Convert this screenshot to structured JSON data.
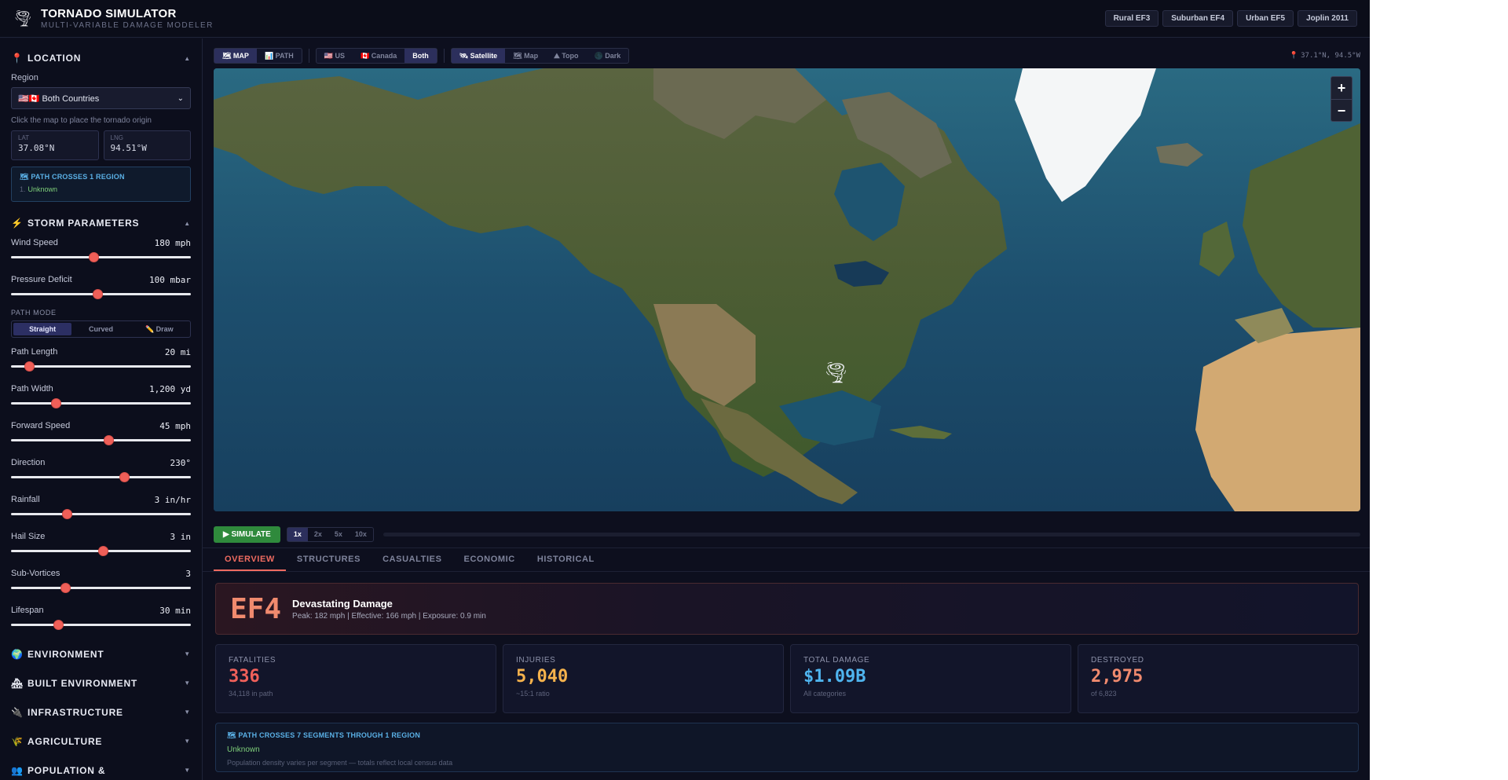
{
  "header": {
    "title": "TORNADO SIMULATOR",
    "subtitle": "MULTI-VARIABLE DAMAGE MODELER",
    "presets": [
      "Rural EF3",
      "Suburban EF4",
      "Urban EF5",
      "Joplin 2011"
    ]
  },
  "location": {
    "title": "LOCATION",
    "region_label": "Region",
    "region_value": "🇺🇸🇨🇦 Both Countries",
    "hint": "Click the map to place the tornado origin",
    "lat_label": "LAT",
    "lat_value": "37.08°N",
    "lng_label": "LNG",
    "lng_value": "94.51°W",
    "cross_title": "🗺 PATH CROSSES 1 REGION",
    "cross_index": "1.",
    "cross_item": "Unknown"
  },
  "storm": {
    "title": "STORM PARAMETERS",
    "path_mode_label": "PATH MODE",
    "path_modes": [
      "Straight",
      "Curved",
      "✏️ Draw"
    ],
    "params": [
      {
        "name": "Wind Speed",
        "value": "180 mph",
        "level": 0.46
      },
      {
        "name": "Pressure Deficit",
        "value": "100 mbar",
        "level": 0.48
      }
    ],
    "params2": [
      {
        "name": "Path Length",
        "value": "20 mi",
        "level": 0.1
      },
      {
        "name": "Path Width",
        "value": "1,200 yd",
        "level": 0.25
      },
      {
        "name": "Forward Speed",
        "value": "45 mph",
        "level": 0.54
      },
      {
        "name": "Direction",
        "value": "230°",
        "level": 0.63
      },
      {
        "name": "Rainfall",
        "value": "3 in/hr",
        "level": 0.31
      },
      {
        "name": "Hail Size",
        "value": "3 in",
        "level": 0.51
      },
      {
        "name": "Sub-Vortices",
        "value": "3",
        "level": 0.3
      },
      {
        "name": "Lifespan",
        "value": "30 min",
        "level": 0.26
      }
    ]
  },
  "collapsed_sections": [
    "ENVIRONMENT",
    "BUILT ENVIRONMENT",
    "INFRASTRUCTURE",
    "AGRICULTURE",
    "POPULATION &"
  ],
  "toolbar": {
    "view_modes": [
      "🗺 MAP",
      "📊 PATH"
    ],
    "countries": [
      "🇺🇸 US",
      "🇨🇦 Canada",
      "Both"
    ],
    "layers": [
      "🛰 Satellite",
      "🗺 Map",
      "⛰ Topo",
      "🌑 Dark"
    ],
    "coords": "37.1°N, 94.5°W"
  },
  "map": {
    "zoom_in": "+",
    "zoom_out": "−"
  },
  "sim": {
    "simulate": "▶ SIMULATE",
    "speeds": [
      "1x",
      "2x",
      "5x",
      "10x"
    ]
  },
  "tabs": [
    "OVERVIEW",
    "STRUCTURES",
    "CASUALTIES",
    "ECONOMIC",
    "HISTORICAL"
  ],
  "result": {
    "rating": "EF4",
    "title": "Devastating Damage",
    "detail": "Peak: 182 mph | Effective: 166 mph | Exposure: 0.9 min"
  },
  "stats": [
    {
      "label": "FATALITIES",
      "value": "336",
      "sub": "34,118 in path",
      "color": "#f0605a"
    },
    {
      "label": "INJURIES",
      "value": "5,040",
      "sub": "~15:1 ratio",
      "color": "#f5b24c"
    },
    {
      "label": "TOTAL DAMAGE",
      "value": "$1.09B",
      "sub": "All categories",
      "color": "#4fb4ee"
    },
    {
      "label": "DESTROYED",
      "value": "2,975",
      "sub": "of 6,823",
      "color": "#f08a6e"
    }
  ],
  "path_summary": {
    "title": "🗺 PATH CROSSES 7 SEGMENTS THROUGH 1 REGION",
    "region": "Unknown",
    "note": "Population density varies per segment — totals reflect local census data"
  }
}
